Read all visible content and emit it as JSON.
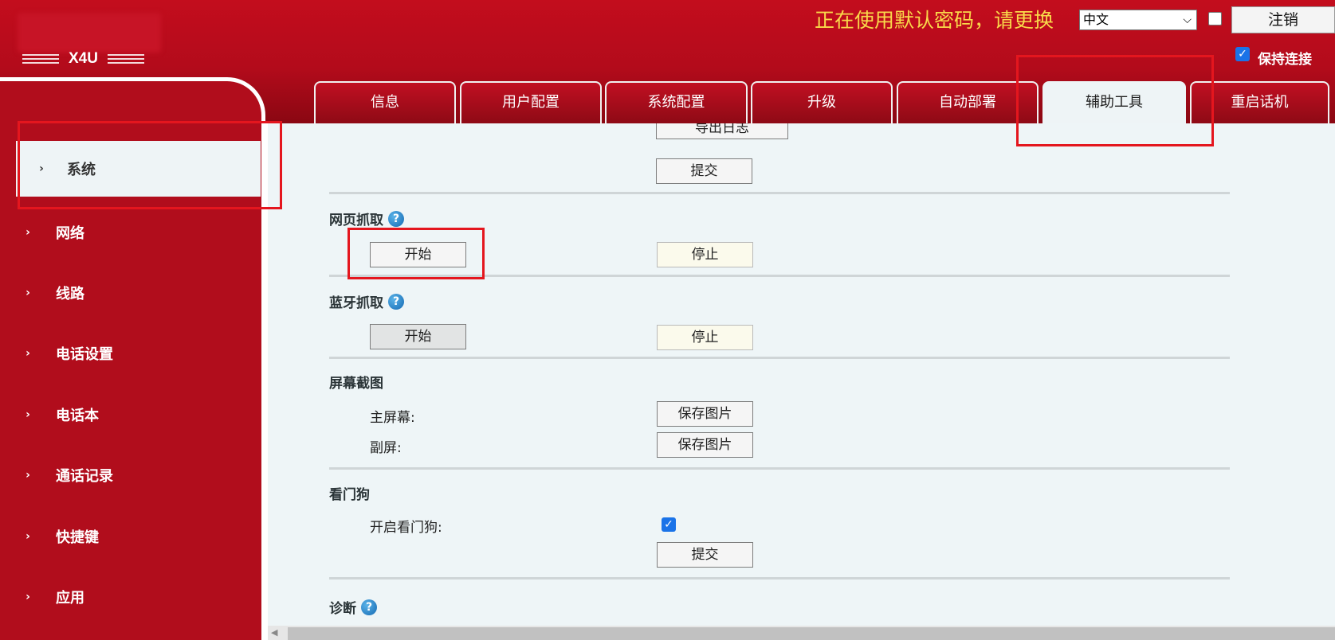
{
  "header": {
    "model": "X4U",
    "warning": "正在使用默认密码，请更换",
    "language": {
      "selected": "中文"
    },
    "logout_label": "注销",
    "keep_connected_label": "保持连接"
  },
  "tabs": [
    {
      "label": "信息"
    },
    {
      "label": "用户配置"
    },
    {
      "label": "系统配置"
    },
    {
      "label": "升级"
    },
    {
      "label": "自动部署"
    },
    {
      "label": "辅助工具",
      "active": true
    },
    {
      "label": "重启话机"
    }
  ],
  "sidebar": {
    "items": [
      {
        "label": "系统",
        "active": true
      },
      {
        "label": "网络"
      },
      {
        "label": "线路"
      },
      {
        "label": "电话设置"
      },
      {
        "label": "电话本"
      },
      {
        "label": "通话记录"
      },
      {
        "label": "快捷键"
      },
      {
        "label": "应用"
      }
    ]
  },
  "main": {
    "log": {
      "export_label": "导出日志",
      "submit_label": "提交"
    },
    "web_capture": {
      "title": "网页抓取",
      "start_label": "开始",
      "stop_label": "停止"
    },
    "bt_capture": {
      "title": "蓝牙抓取",
      "start_label": "开始",
      "stop_label": "停止"
    },
    "screenshot": {
      "title": "屏幕截图",
      "main_label": "主屏幕:",
      "sub_label": "副屏:",
      "save_label": "保存图片"
    },
    "watchdog": {
      "title": "看门狗",
      "enable_label": "开启看门狗:",
      "enabled": true,
      "submit_label": "提交"
    },
    "diagnosis": {
      "title": "诊断"
    }
  },
  "colors": {
    "brand_red": "#b10d1c",
    "warning_yellow": "#f9d94a",
    "content_bg": "#eef5f7",
    "annotation_red": "#e4161e"
  }
}
